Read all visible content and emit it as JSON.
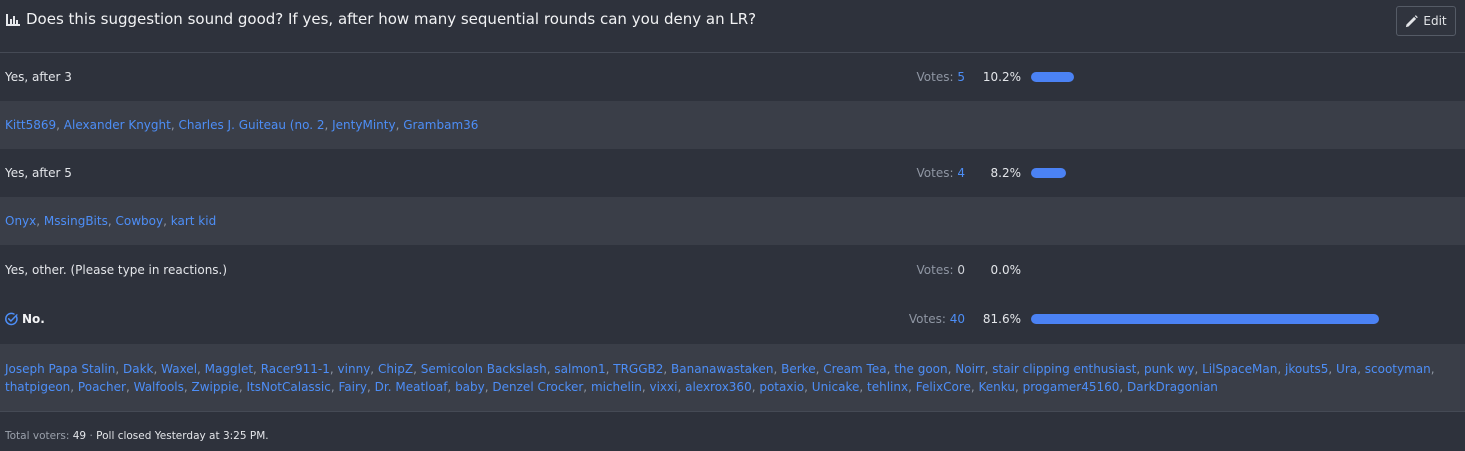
{
  "poll": {
    "title": "Does this suggestion sound good? If yes, after how many sequential rounds can you deny an LR?",
    "edit_label": "Edit",
    "icons": {
      "title": "bar-chart-icon",
      "edit": "pencil-icon",
      "winner": "check-circle-icon"
    },
    "votes_prefix": "Votes: ",
    "options": [
      {
        "label": "Yes, after 3",
        "votes": "5",
        "percent": "10.2%",
        "fraction": 0.102,
        "voters": [
          "Kitt5869",
          "Alexander Knyght",
          "Charles J. Guiteau (no. 2",
          "JentyMinty",
          "Grambam36"
        ]
      },
      {
        "label": "Yes, after 5",
        "votes": "4",
        "percent": "8.2%",
        "fraction": 0.082,
        "voters": [
          "Onyx",
          "MssingBits",
          "Cowboy",
          "kart kid"
        ]
      },
      {
        "label": "Yes, other. (Please type in reactions.)",
        "votes": "0",
        "percent": "0.0%",
        "fraction": 0.0,
        "voters": []
      },
      {
        "label": "No.",
        "votes": "40",
        "percent": "81.6%",
        "fraction": 0.816,
        "winner": true,
        "voters": [
          "Joseph Papa Stalin",
          "Dakk",
          "Waxel",
          "Magglet",
          "Racer911-1",
          "vinny",
          "ChipZ",
          "Semicolon Backslash",
          "salmon1",
          "TRGGB2",
          "Bananawastaken",
          "Berke",
          "Cream Tea",
          "the goon",
          "Noirr",
          "stair clipping enthusiast",
          "punk wy",
          "LilSpaceMan",
          "jkouts5",
          "Ura",
          "scootyman",
          "thatpigeon",
          "Poacher",
          "Walfools",
          "Zwippie",
          "ItsNotCalassic",
          "Fairy",
          "Dr. Meatloaf",
          "baby",
          "Denzel Crocker",
          "michelin",
          "vixxi",
          "alexrox360",
          "potaxio",
          "Unicake",
          "tehlinx",
          "FelixCore",
          "Kenku",
          "progamer45160",
          "DarkDragonian"
        ]
      }
    ],
    "footer": {
      "total_label": "Total voters: ",
      "total_value": "49",
      "separator": " · ",
      "closed_text": "Poll closed Yesterday at 3:25 PM."
    },
    "colors": {
      "accent": "#4b82f4",
      "link": "#4d8ef7",
      "background": "#2e323c",
      "voter_row": "#3a3e48"
    }
  }
}
